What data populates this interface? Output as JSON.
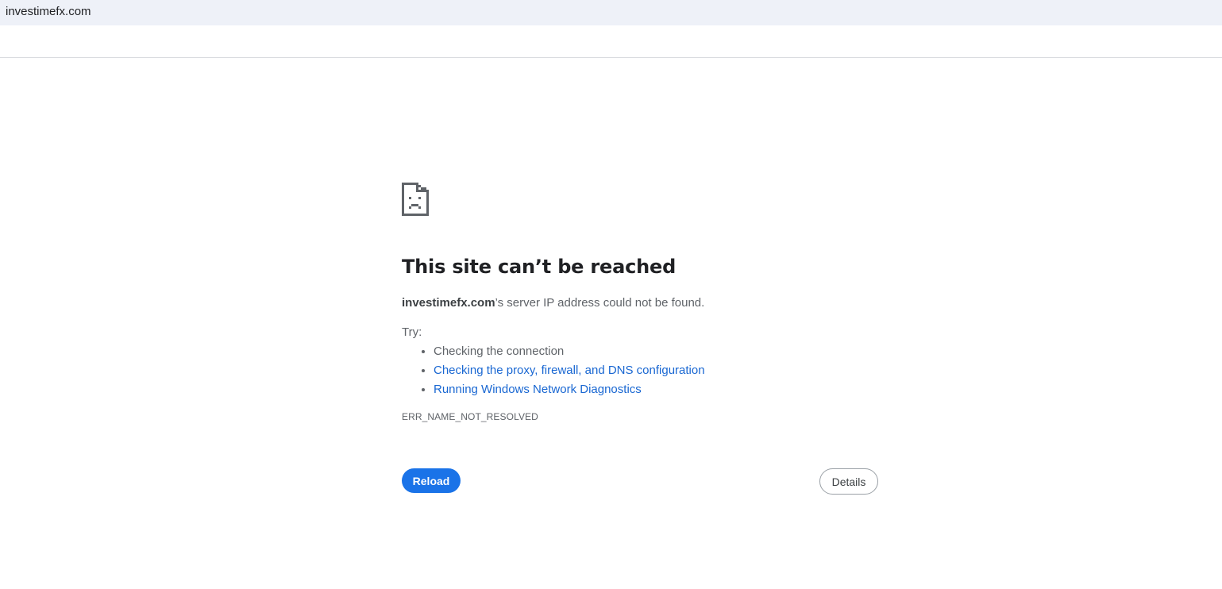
{
  "address_bar": {
    "url": "investimefx.com"
  },
  "error_page": {
    "icon": "sad-page-icon",
    "headline": "This site can’t be reached",
    "summary_host": "investimefx.com",
    "summary_rest": "’s server IP address could not be found.",
    "try_label": "Try:",
    "suggestions": [
      {
        "text": "Checking the connection",
        "is_link": false
      },
      {
        "text": "Checking the proxy, firewall, and DNS configuration",
        "is_link": true
      },
      {
        "text": "Running Windows Network Diagnostics",
        "is_link": true
      }
    ],
    "error_code": "ERR_NAME_NOT_RESOLVED",
    "reload_label": "Reload",
    "details_label": "Details"
  },
  "colors": {
    "link": "#1967d2",
    "primary_button": "#1a73e8",
    "address_bar_bg": "#eef1f8"
  }
}
